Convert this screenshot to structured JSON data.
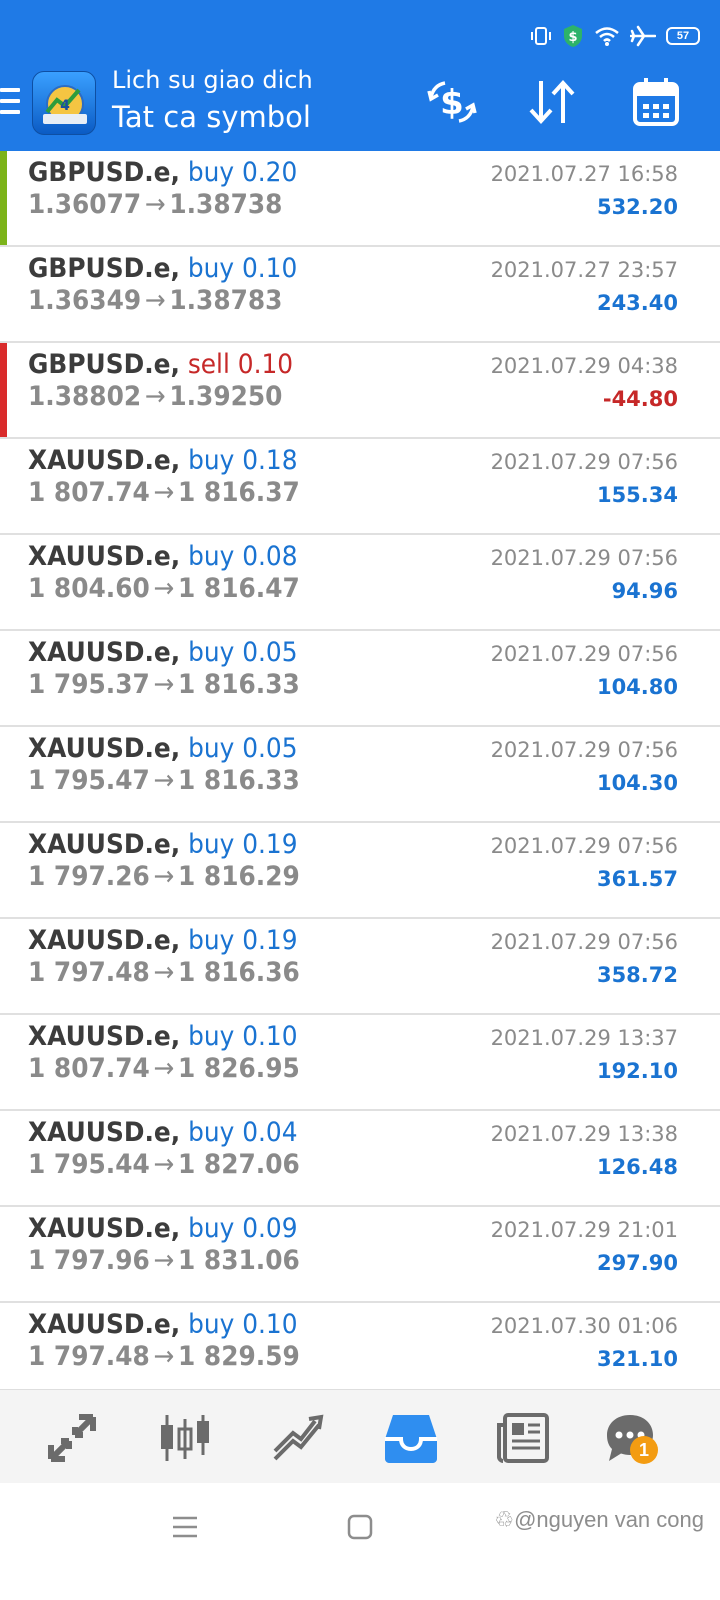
{
  "header": {
    "title": "Lich su giao dich",
    "subtitle": "Tat ca symbol",
    "battery": "57",
    "colors": {
      "header_bg": "#1f7ae6",
      "buy": "#1a73d1",
      "sell": "#c62828"
    }
  },
  "trades": [
    {
      "symbol": "GBPUSD.e,",
      "type": "buy",
      "volume": "0.20",
      "open": "1.36077",
      "close": "1.38738",
      "time": "2021.07.27 16:58",
      "profit": "532.20",
      "marker": "#7cb31a"
    },
    {
      "symbol": "GBPUSD.e,",
      "type": "buy",
      "volume": "0.10",
      "open": "1.36349",
      "close": "1.38783",
      "time": "2021.07.27 23:57",
      "profit": "243.40",
      "marker": ""
    },
    {
      "symbol": "GBPUSD.e,",
      "type": "sell",
      "volume": "0.10",
      "open": "1.38802",
      "close": "1.39250",
      "time": "2021.07.29 04:38",
      "profit": "-44.80",
      "marker": "#d92b2b"
    },
    {
      "symbol": "XAUUSD.e,",
      "type": "buy",
      "volume": "0.18",
      "open": "1 807.74",
      "close": "1 816.37",
      "time": "2021.07.29 07:56",
      "profit": "155.34",
      "marker": ""
    },
    {
      "symbol": "XAUUSD.e,",
      "type": "buy",
      "volume": "0.08",
      "open": "1 804.60",
      "close": "1 816.47",
      "time": "2021.07.29 07:56",
      "profit": "94.96",
      "marker": ""
    },
    {
      "symbol": "XAUUSD.e,",
      "type": "buy",
      "volume": "0.05",
      "open": "1 795.37",
      "close": "1 816.33",
      "time": "2021.07.29 07:56",
      "profit": "104.80",
      "marker": ""
    },
    {
      "symbol": "XAUUSD.e,",
      "type": "buy",
      "volume": "0.05",
      "open": "1 795.47",
      "close": "1 816.33",
      "time": "2021.07.29 07:56",
      "profit": "104.30",
      "marker": ""
    },
    {
      "symbol": "XAUUSD.e,",
      "type": "buy",
      "volume": "0.19",
      "open": "1 797.26",
      "close": "1 816.29",
      "time": "2021.07.29 07:56",
      "profit": "361.57",
      "marker": ""
    },
    {
      "symbol": "XAUUSD.e,",
      "type": "buy",
      "volume": "0.19",
      "open": "1 797.48",
      "close": "1 816.36",
      "time": "2021.07.29 07:56",
      "profit": "358.72",
      "marker": ""
    },
    {
      "symbol": "XAUUSD.e,",
      "type": "buy",
      "volume": "0.10",
      "open": "1 807.74",
      "close": "1 826.95",
      "time": "2021.07.29 13:37",
      "profit": "192.10",
      "marker": ""
    },
    {
      "symbol": "XAUUSD.e,",
      "type": "buy",
      "volume": "0.04",
      "open": "1 795.44",
      "close": "1 827.06",
      "time": "2021.07.29 13:38",
      "profit": "126.48",
      "marker": ""
    },
    {
      "symbol": "XAUUSD.e,",
      "type": "buy",
      "volume": "0.09",
      "open": "1 797.96",
      "close": "1 831.06",
      "time": "2021.07.29 21:01",
      "profit": "297.90",
      "marker": ""
    },
    {
      "symbol": "XAUUSD.e,",
      "type": "buy",
      "volume": "0.10",
      "open": "1 797.48",
      "close": "1 829.59",
      "time": "2021.07.30 01:06",
      "profit": "321.10",
      "marker": ""
    }
  ],
  "bottom_nav": {
    "items": [
      "quotes-icon",
      "chart-icon",
      "trade-icon",
      "history-icon",
      "news-icon",
      "chat-icon"
    ],
    "active": "history-icon",
    "chat_badge": "1"
  },
  "watermark": "@nguyen van cong"
}
